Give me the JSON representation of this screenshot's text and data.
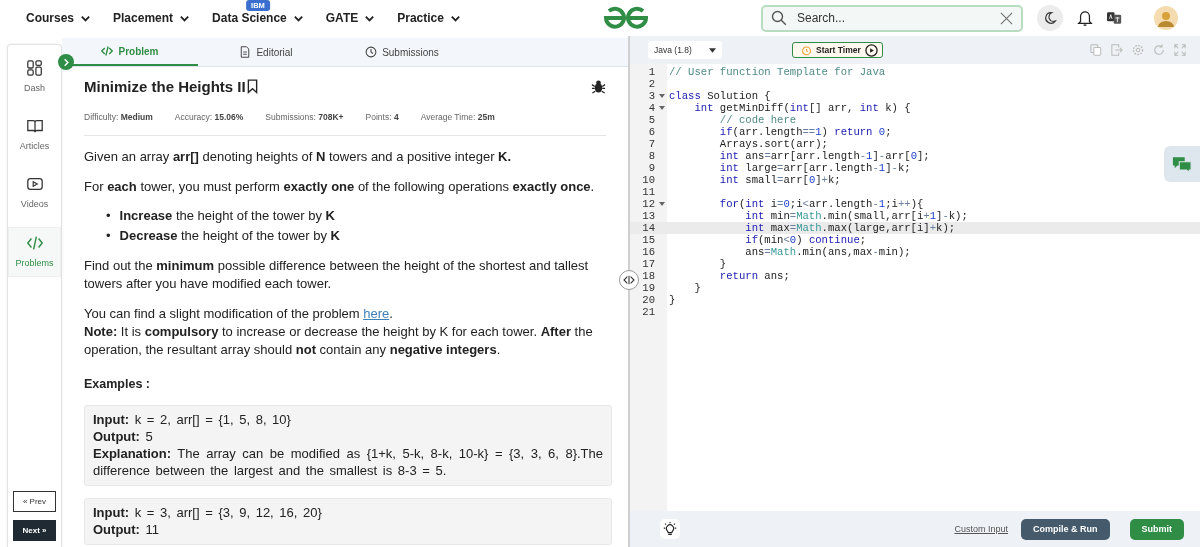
{
  "nav": {
    "items": [
      {
        "label": "Courses"
      },
      {
        "label": "Placement"
      },
      {
        "label": "Data Science",
        "badge": "IBM"
      },
      {
        "label": "GATE"
      },
      {
        "label": "Practice"
      }
    ],
    "search": {
      "placeholder": "Search..."
    }
  },
  "sidebar": {
    "items": [
      {
        "label": "Dash",
        "selected": false
      },
      {
        "label": "Articles",
        "selected": false
      },
      {
        "label": "Videos",
        "selected": false
      },
      {
        "label": "Problems",
        "selected": true
      }
    ],
    "prev": "« Prev",
    "next": "Next »"
  },
  "tabs": [
    {
      "label": "Problem",
      "selected": true
    },
    {
      "label": "Editorial",
      "selected": false
    },
    {
      "label": "Submissions",
      "selected": false
    }
  ],
  "problem": {
    "title": "Minimize the Heights II",
    "meta": [
      {
        "label": "Difficulty:",
        "value": "Medium"
      },
      {
        "label": "Accuracy:",
        "value": "15.06%"
      },
      {
        "label": "Submissions:",
        "value": "708K+"
      },
      {
        "label": "Points:",
        "value": "4"
      },
      {
        "label": "Average Time:",
        "value": "25m"
      }
    ],
    "body": [
      {
        "kind": "p",
        "text": "Given an array **arr[]** denoting heights of **N** towers and a positive integer **K.**"
      },
      {
        "kind": "p",
        "text": "For **each** tower, you must perform **exactly one** of the following operations **exactly once**."
      },
      {
        "kind": "list",
        "items": [
          {
            "marker": "•",
            "text": "**Increase** the height of the tower by **K**"
          },
          {
            "marker": "•",
            "text": "**Decrease** the height of the tower by **K**"
          }
        ]
      },
      {
        "kind": "p",
        "text": "Find out the **minimum** possible difference between the height of the shortest and tallest towers after you have modified each tower."
      },
      {
        "kind": "link_paragraph",
        "before": "You can find a slight modification of the problem ",
        "link": "here",
        "after": ".",
        "note": "**Note:** It is **compulsory** to increase or decrease the height by K for each tower. **After** the operation, the resultant array should **not** contain any **negative integers**."
      }
    ],
    "examples_heading": "Examples :",
    "examples": [
      {
        "lines": [
          "**Input:** k = 2, arr[] = {1, 5, 8, 10}",
          "**Output:** 5",
          "**Explanation:** The array can be modified as {1+k, 5-k, 8-k, 10-k} = {3, 3, 6, 8}.The difference between the largest and the smallest is 8-3 = 5."
        ]
      },
      {
        "lines": [
          "**Input:** k = 3, arr[] = {3, 9, 12, 16, 20}",
          "**Output:** 11"
        ]
      }
    ]
  },
  "editor": {
    "language": "Java (1.8)",
    "timer": "Start Timer",
    "code": [
      {
        "n": "1",
        "tokens": [
          {
            "kind": "comment",
            "text": "// User function Template for Java"
          }
        ]
      },
      {
        "n": "2"
      },
      {
        "n": "3",
        "fold": true,
        "tokens": [
          {
            "kind": "keyword",
            "text": "class"
          },
          {
            "kind": "plain",
            "text": " Solution {"
          }
        ]
      },
      {
        "n": "4",
        "fold": true,
        "tokens": [
          {
            "kind": "keyword",
            "text": "    int"
          },
          {
            "kind": "plain",
            "text": " getMinDiff("
          },
          {
            "kind": "keyword",
            "text": "int"
          },
          {
            "kind": "plain",
            "text": "[] arr, "
          },
          {
            "kind": "keyword",
            "text": "int"
          },
          {
            "kind": "plain",
            "text": " k) {"
          }
        ]
      },
      {
        "n": "5",
        "tokens": [
          {
            "kind": "comment",
            "text": "        // code here"
          }
        ]
      },
      {
        "n": "6",
        "tokens": [
          {
            "kind": "keyword",
            "text": "        if"
          },
          {
            "kind": "plain",
            "text": "(arr.length"
          },
          {
            "kind": "operator",
            "text": "=="
          },
          {
            "kind": "number",
            "text": "1"
          },
          {
            "kind": "plain",
            "text": ") "
          },
          {
            "kind": "keyword",
            "text": "return"
          },
          {
            "kind": "number",
            "text": " 0"
          },
          {
            "kind": "plain",
            "text": ";"
          }
        ]
      },
      {
        "n": "7",
        "tokens": [
          {
            "kind": "plain",
            "text": "        Arrays.sort(arr);"
          }
        ]
      },
      {
        "n": "8",
        "tokens": [
          {
            "kind": "keyword",
            "text": "        int"
          },
          {
            "kind": "plain",
            "text": " ans"
          },
          {
            "kind": "operator",
            "text": "="
          },
          {
            "kind": "plain",
            "text": "arr[arr.length"
          },
          {
            "kind": "operator",
            "text": "-"
          },
          {
            "kind": "number",
            "text": "1"
          },
          {
            "kind": "plain",
            "text": "]"
          },
          {
            "kind": "operator",
            "text": "-"
          },
          {
            "kind": "plain",
            "text": "arr["
          },
          {
            "kind": "number",
            "text": "0"
          },
          {
            "kind": "plain",
            "text": "];"
          }
        ]
      },
      {
        "n": "9",
        "tokens": [
          {
            "kind": "keyword",
            "text": "        int"
          },
          {
            "kind": "plain",
            "text": " large"
          },
          {
            "kind": "operator",
            "text": "="
          },
          {
            "kind": "plain",
            "text": "arr[arr.length"
          },
          {
            "kind": "operator",
            "text": "-"
          },
          {
            "kind": "number",
            "text": "1"
          },
          {
            "kind": "plain",
            "text": "]"
          },
          {
            "kind": "operator",
            "text": "-"
          },
          {
            "kind": "plain",
            "text": "k;"
          }
        ]
      },
      {
        "n": "10",
        "tokens": [
          {
            "kind": "keyword",
            "text": "        int"
          },
          {
            "kind": "plain",
            "text": " small"
          },
          {
            "kind": "operator",
            "text": "="
          },
          {
            "kind": "plain",
            "text": "arr["
          },
          {
            "kind": "number",
            "text": "0"
          },
          {
            "kind": "plain",
            "text": "]"
          },
          {
            "kind": "operator",
            "text": "+"
          },
          {
            "kind": "plain",
            "text": "k;"
          }
        ]
      },
      {
        "n": "11"
      },
      {
        "n": "12",
        "fold": true,
        "tokens": [
          {
            "kind": "keyword",
            "text": "        for"
          },
          {
            "kind": "plain",
            "text": "("
          },
          {
            "kind": "keyword",
            "text": "int"
          },
          {
            "kind": "plain",
            "text": " i"
          },
          {
            "kind": "operator",
            "text": "="
          },
          {
            "kind": "number",
            "text": "0"
          },
          {
            "kind": "plain",
            "text": ";i"
          },
          {
            "kind": "operator",
            "text": "<"
          },
          {
            "kind": "plain",
            "text": "arr.length"
          },
          {
            "kind": "operator",
            "text": "-"
          },
          {
            "kind": "number",
            "text": "1"
          },
          {
            "kind": "plain",
            "text": ";i"
          },
          {
            "kind": "operator",
            "text": "++"
          },
          {
            "kind": "plain",
            "text": "){"
          }
        ]
      },
      {
        "n": "13",
        "tokens": [
          {
            "kind": "keyword",
            "text": "            int"
          },
          {
            "kind": "plain",
            "text": " min"
          },
          {
            "kind": "operator",
            "text": "="
          },
          {
            "kind": "class",
            "text": "Math"
          },
          {
            "kind": "plain",
            "text": ".min(small,arr[i"
          },
          {
            "kind": "operator",
            "text": "+"
          },
          {
            "kind": "number",
            "text": "1"
          },
          {
            "kind": "plain",
            "text": "]"
          },
          {
            "kind": "operator",
            "text": "-"
          },
          {
            "kind": "plain",
            "text": "k);"
          }
        ]
      },
      {
        "n": "14",
        "active": true,
        "tokens": [
          {
            "kind": "keyword",
            "text": "            int"
          },
          {
            "kind": "plain",
            "text": " max"
          },
          {
            "kind": "operator",
            "text": "="
          },
          {
            "kind": "class",
            "text": "Math"
          },
          {
            "kind": "plain",
            "text": ".max(large,arr[i]"
          },
          {
            "kind": "operator",
            "text": "+"
          },
          {
            "kind": "plain",
            "text": "k);"
          }
        ]
      },
      {
        "n": "15",
        "tokens": [
          {
            "kind": "keyword",
            "text": "            if"
          },
          {
            "kind": "plain",
            "text": "(min"
          },
          {
            "kind": "operator",
            "text": "<"
          },
          {
            "kind": "number",
            "text": "0"
          },
          {
            "kind": "plain",
            "text": ") "
          },
          {
            "kind": "keyword",
            "text": "continue"
          },
          {
            "kind": "plain",
            "text": ";"
          }
        ]
      },
      {
        "n": "16",
        "tokens": [
          {
            "kind": "plain",
            "text": "            ans"
          },
          {
            "kind": "operator",
            "text": "="
          },
          {
            "kind": "class",
            "text": "Math"
          },
          {
            "kind": "plain",
            "text": ".min(ans,max"
          },
          {
            "kind": "operator",
            "text": "-"
          },
          {
            "kind": "plain",
            "text": "min);"
          }
        ]
      },
      {
        "n": "17",
        "tokens": [
          {
            "kind": "plain",
            "text": "        }"
          }
        ]
      },
      {
        "n": "18",
        "tokens": [
          {
            "kind": "keyword",
            "text": "        return"
          },
          {
            "kind": "plain",
            "text": " ans;"
          }
        ]
      },
      {
        "n": "19",
        "tokens": [
          {
            "kind": "plain",
            "text": "    }"
          }
        ]
      },
      {
        "n": "20",
        "tokens": [
          {
            "kind": "plain",
            "text": "}"
          }
        ]
      },
      {
        "n": "21"
      }
    ],
    "custom_input": "Custom Input",
    "compile": "Compile & Run",
    "submit": "Submit"
  }
}
